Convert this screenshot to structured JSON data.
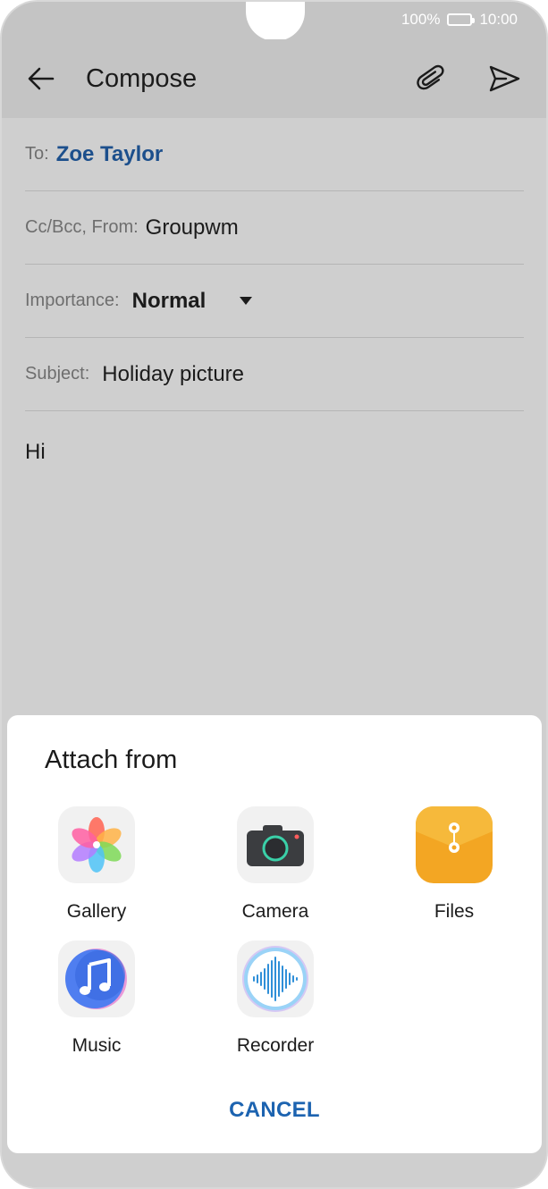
{
  "status": {
    "battery": "100%",
    "time": "10:00"
  },
  "appbar": {
    "title": "Compose"
  },
  "form": {
    "to_label": "To:",
    "to_value": "Zoe Taylor",
    "ccbcc_label": "Cc/Bcc, From:",
    "from_value": "Groupwm",
    "importance_label": "Importance:",
    "importance_value": "Normal",
    "subject_label": "Subject:",
    "subject_value": "Holiday picture",
    "body": "Hi"
  },
  "sheet": {
    "title": "Attach from",
    "options": [
      {
        "label": "Gallery",
        "icon": "gallery-icon"
      },
      {
        "label": "Camera",
        "icon": "camera-icon"
      },
      {
        "label": "Files",
        "icon": "files-icon"
      },
      {
        "label": "Music",
        "icon": "music-icon"
      },
      {
        "label": "Recorder",
        "icon": "recorder-icon"
      }
    ],
    "cancel": "CANCEL"
  },
  "colors": {
    "accent": "#1c63b0",
    "to_name": "#1c4f8c",
    "files": "#f3a623"
  }
}
